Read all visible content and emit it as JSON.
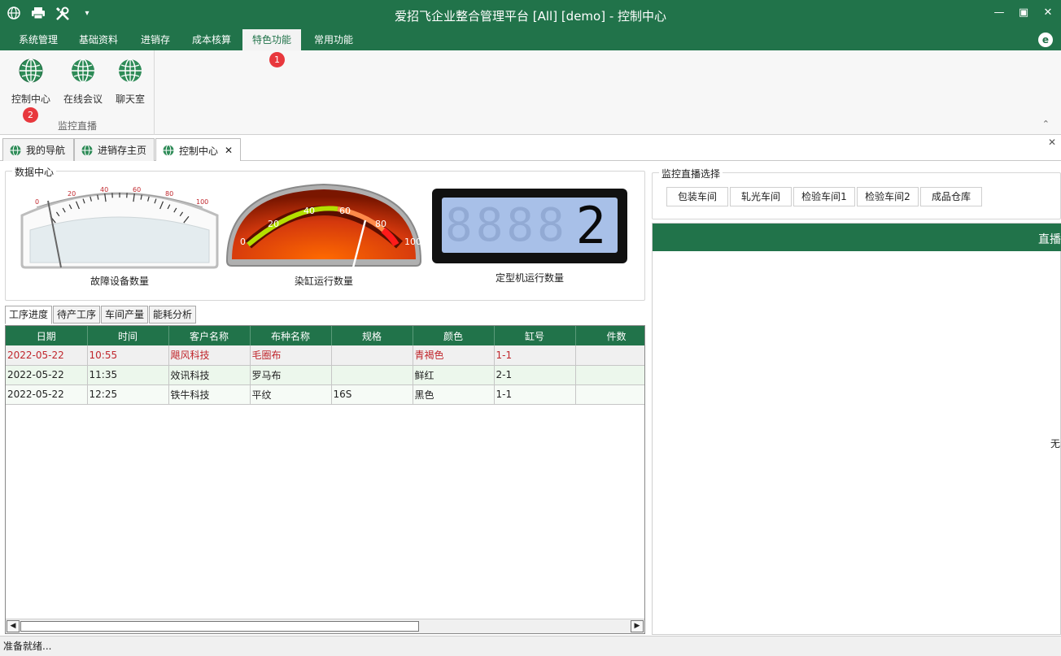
{
  "titlebar": {
    "title": "爱招飞企业整合管理平台 [All] [demo] - 控制中心",
    "quick_access": [
      "globe-icon",
      "print-icon",
      "tools-icon",
      "customize-icon"
    ],
    "window_buttons": [
      "minimize-icon",
      "maximize-icon",
      "close-icon"
    ]
  },
  "menu": {
    "tabs": [
      {
        "label": "系统管理",
        "active": false
      },
      {
        "label": "基础资料",
        "active": false
      },
      {
        "label": "进销存",
        "active": false
      },
      {
        "label": "成本核算",
        "active": false
      },
      {
        "label": "特色功能",
        "active": true
      },
      {
        "label": "常用功能",
        "active": false
      }
    ]
  },
  "ribbon": {
    "buttons": [
      {
        "label": "控制中心",
        "icon": "globe-icon"
      },
      {
        "label": "在线会议",
        "icon": "globe-icon"
      },
      {
        "label": "聊天室",
        "icon": "globe-icon"
      }
    ],
    "group_label": "监控直播",
    "badges": [
      "1",
      "2"
    ]
  },
  "doc_tabs": [
    {
      "label": "我的导航"
    },
    {
      "label": "进销存主页"
    },
    {
      "label": "控制中心",
      "active": true,
      "closable": true
    }
  ],
  "data_center": {
    "title": "数据中心",
    "gauges": [
      {
        "label": "故障设备数量",
        "value": 3,
        "max": 100,
        "ticks": [
          "0",
          "20",
          "40",
          "60",
          "80",
          "100"
        ]
      },
      {
        "label": "染缸运行数量",
        "value": 78,
        "max": 100,
        "ticks": [
          "0",
          "20",
          "40",
          "60",
          "80",
          "100"
        ]
      },
      {
        "label": "定型机运行数量",
        "value": 2,
        "display": "2"
      }
    ]
  },
  "inner_tabs": [
    {
      "label": "工序进度",
      "active": true
    },
    {
      "label": "待产工序"
    },
    {
      "label": "车间产量"
    },
    {
      "label": "能耗分析"
    }
  ],
  "table": {
    "columns": [
      "日期",
      "时间",
      "客户名称",
      "布种名称",
      "规格",
      "颜色",
      "缸号",
      "件数"
    ],
    "rows": [
      [
        "2022-05-22",
        "10:55",
        "飓风科技",
        "毛圈布",
        "",
        "青褐色",
        "1-1",
        ""
      ],
      [
        "2022-05-22",
        "11:35",
        "效讯科技",
        "罗马布",
        "",
        "鲜红",
        "2-1",
        ""
      ],
      [
        "2022-05-22",
        "12:25",
        "铁牛科技",
        "平纹",
        "16S",
        "黑色",
        "1-1",
        ""
      ]
    ]
  },
  "live": {
    "group_title": "监控直播选择",
    "cameras": [
      "包装车间",
      "轧光车间",
      "检验车间1",
      "检验车间2",
      "成品仓库"
    ],
    "header": "直播",
    "message": "无"
  },
  "status": {
    "text": "准备就绪..."
  },
  "colors": {
    "brand": "#21734a",
    "badge": "#e8383d",
    "highlight_row": "#c0262c"
  }
}
